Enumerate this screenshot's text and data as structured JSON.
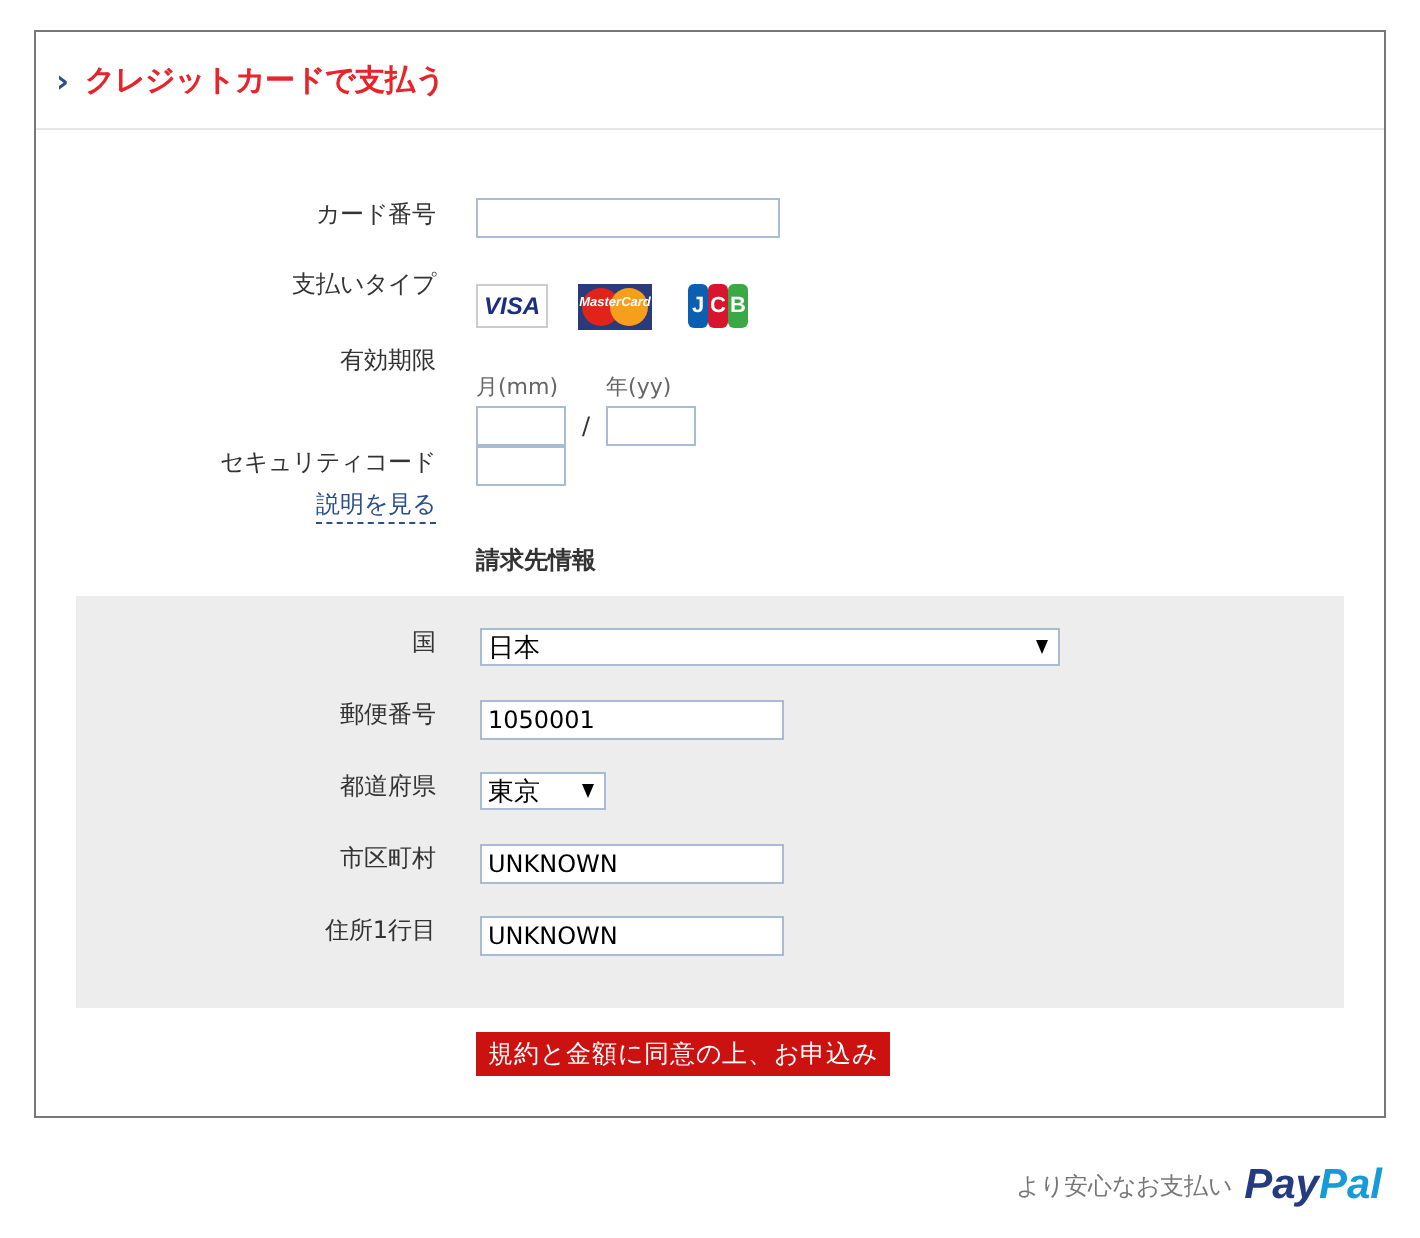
{
  "header": {
    "chevron": "›",
    "title": "クレジットカードで支払う"
  },
  "card_number": {
    "label": "カード番号"
  },
  "payment_type": {
    "label": "支払いタイプ",
    "brands": [
      {
        "kind": "visa",
        "text": "VISA"
      },
      {
        "kind": "mastercard",
        "text": "MasterCard"
      },
      {
        "kind": "jcb",
        "text": "JCB"
      }
    ]
  },
  "expiry": {
    "label": "有効期限",
    "month_label": "月(mm)",
    "year_label": "年(yy)",
    "separator": "/"
  },
  "security_code": {
    "label": "セキュリティコード",
    "help_link": "説明を見る"
  },
  "billing": {
    "heading": "請求先情報",
    "fields": [
      {
        "kind": "wide_select",
        "label": "国",
        "value": "日本"
      },
      {
        "kind": "text",
        "label": "郵便番号",
        "value": "1050001"
      },
      {
        "kind": "narrow_select",
        "label": "都道府県",
        "value": "東京"
      },
      {
        "kind": "text",
        "label": "市区町村",
        "value": "UNKNOWN"
      },
      {
        "kind": "text",
        "label": "住所1行目",
        "value": "UNKNOWN"
      }
    ]
  },
  "submit_button": "規約と金額に同意の上、お申込み",
  "footer": {
    "text": "より安心なお支払い",
    "logo": [
      "Pay",
      "Pal"
    ]
  }
}
